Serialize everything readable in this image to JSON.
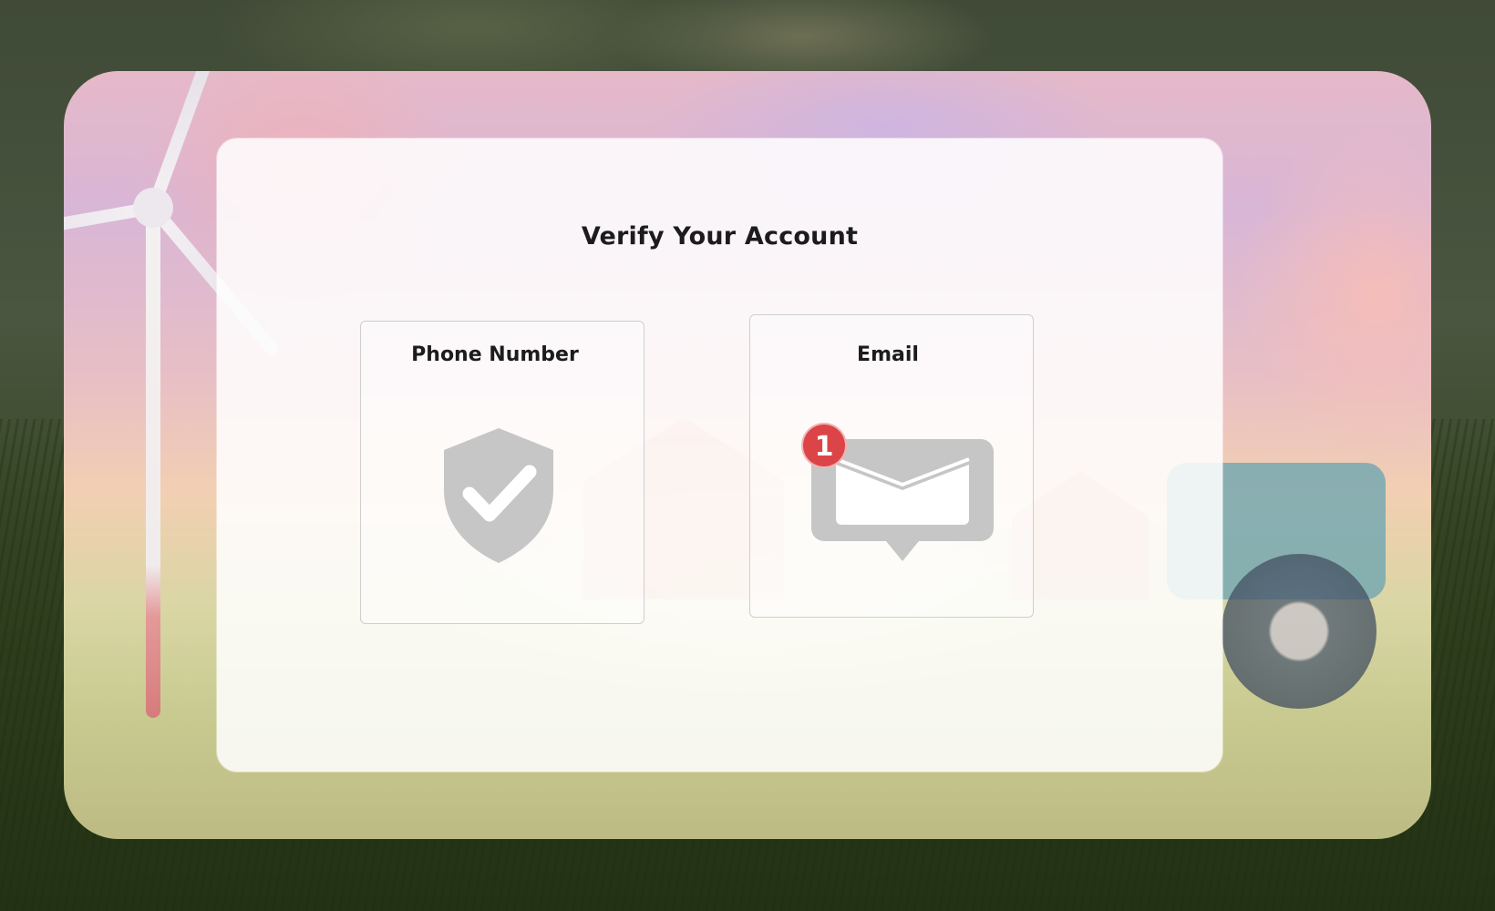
{
  "page": {
    "title": "Verify Your Account"
  },
  "options": {
    "phone": {
      "label": "Phone Number",
      "icon": "shield-check-icon"
    },
    "email": {
      "label": "Email",
      "icon": "mail-icon",
      "badge_count": "1"
    }
  },
  "colors": {
    "icon_gray": "#c6c6c6",
    "badge_red": "#dc4548",
    "card_bg": "#ffffff",
    "text": "#1c1c1c"
  }
}
